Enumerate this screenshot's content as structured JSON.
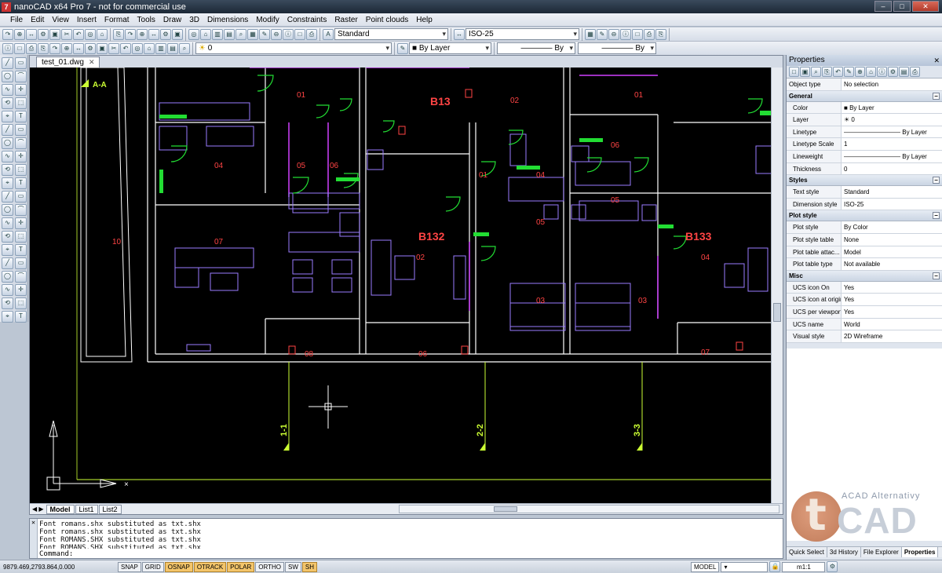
{
  "window": {
    "title": "nanoCAD x64 Pro 7 - not for commercial use",
    "app_glyph": "7"
  },
  "menu": [
    "File",
    "Edit",
    "View",
    "Insert",
    "Format",
    "Tools",
    "Draw",
    "3D",
    "Dimensions",
    "Modify",
    "Constraints",
    "Raster",
    "Point clouds",
    "Help"
  ],
  "toolbar": {
    "text_style": "Standard",
    "dim_style": "ISO-25",
    "layer": "0",
    "color": "By Layer",
    "linetype": "By Layer",
    "lineweight": "By Layer"
  },
  "document": {
    "tab": "test_01.dwg",
    "layout_tabs": [
      "Model",
      "List1",
      "List2"
    ],
    "active_layout": "Model"
  },
  "drawing": {
    "section_label": "A-A",
    "rooms": [
      {
        "label": "01",
        "kind": "num"
      },
      {
        "label": "B13",
        "kind": "apt"
      },
      {
        "label": "02",
        "kind": "num"
      },
      {
        "label": "01",
        "kind": "num"
      },
      {
        "label": "04",
        "kind": "num"
      },
      {
        "label": "05",
        "kind": "num"
      },
      {
        "label": "06",
        "kind": "num"
      },
      {
        "label": "07",
        "kind": "num"
      },
      {
        "label": "10",
        "kind": "num"
      },
      {
        "label": "01",
        "kind": "num"
      },
      {
        "label": "04",
        "kind": "num"
      },
      {
        "label": "05",
        "kind": "num"
      },
      {
        "label": "B132",
        "kind": "apt"
      },
      {
        "label": "02",
        "kind": "num"
      },
      {
        "label": "03",
        "kind": "num"
      },
      {
        "label": "06",
        "kind": "num"
      },
      {
        "label": "05",
        "kind": "num"
      },
      {
        "label": "B133",
        "kind": "apt"
      },
      {
        "label": "04",
        "kind": "num"
      },
      {
        "label": "03",
        "kind": "num"
      },
      {
        "label": "08",
        "kind": "num"
      },
      {
        "label": "06",
        "kind": "num"
      },
      {
        "label": "07",
        "kind": "num"
      }
    ],
    "axes": [
      "1-1",
      "2-2",
      "3-3"
    ],
    "colors": {
      "background": "#000000",
      "walls": "#ffffff",
      "furniture": "#9a7cff",
      "doors": "#22dd33",
      "text": "#ff4444",
      "axis": "#ccff33"
    }
  },
  "command": {
    "lines": [
      "Font romans.shx substituted as txt.shx",
      "Font romans.shx substituted as txt.shx",
      "Font ROMANS.SHX substituted as txt.shx",
      "Font ROMANS.SHX substituted as txt.shx"
    ],
    "prompt": "Command:"
  },
  "status": {
    "coords": "9879.469,2793.864,0.000",
    "buttons": [
      {
        "label": "SNAP",
        "on": false
      },
      {
        "label": "GRID",
        "on": false
      },
      {
        "label": "OSNAP",
        "on": true
      },
      {
        "label": "OTRACK",
        "on": true
      },
      {
        "label": "POLAR",
        "on": true
      },
      {
        "label": "ORTHO",
        "on": false
      },
      {
        "label": "SW",
        "on": false
      },
      {
        "label": "SH",
        "on": true
      }
    ],
    "space": "MODEL",
    "scale": "m1:1"
  },
  "properties": {
    "title": "Properties",
    "object_type": {
      "key": "Object type",
      "value": "No selection"
    },
    "categories": [
      {
        "name": "General",
        "rows": [
          {
            "key": "Color",
            "value": "By Layer"
          },
          {
            "key": "Layer",
            "value": "0"
          },
          {
            "key": "Linetype",
            "value": "By Layer"
          },
          {
            "key": "Linetype Scale",
            "value": "1"
          },
          {
            "key": "Lineweight",
            "value": "By Layer"
          },
          {
            "key": "Thickness",
            "value": "0"
          }
        ]
      },
      {
        "name": "Styles",
        "rows": [
          {
            "key": "Text style",
            "value": "Standard"
          },
          {
            "key": "Dimension style",
            "value": "ISO-25"
          }
        ]
      },
      {
        "name": "Plot style",
        "rows": [
          {
            "key": "Plot style",
            "value": "By Color"
          },
          {
            "key": "Plot style table",
            "value": "None"
          },
          {
            "key": "Plot table attac...",
            "value": "Model"
          },
          {
            "key": "Plot table type",
            "value": "Not available"
          }
        ]
      },
      {
        "name": "Misc",
        "rows": [
          {
            "key": "UCS icon On",
            "value": "Yes"
          },
          {
            "key": "UCS icon at origin",
            "value": "Yes"
          },
          {
            "key": "UCS per viewport",
            "value": "Yes"
          },
          {
            "key": "UCS name",
            "value": "World"
          },
          {
            "key": "Visual style",
            "value": "2D Wireframe"
          }
        ]
      }
    ],
    "tabs": [
      "Quick Select",
      "3d History",
      "File Explorer",
      "Properties"
    ],
    "active_tab": "Properties"
  },
  "watermark": {
    "subtitle": "ACAD Alternativy",
    "glyph": "t",
    "name": "CAD"
  }
}
